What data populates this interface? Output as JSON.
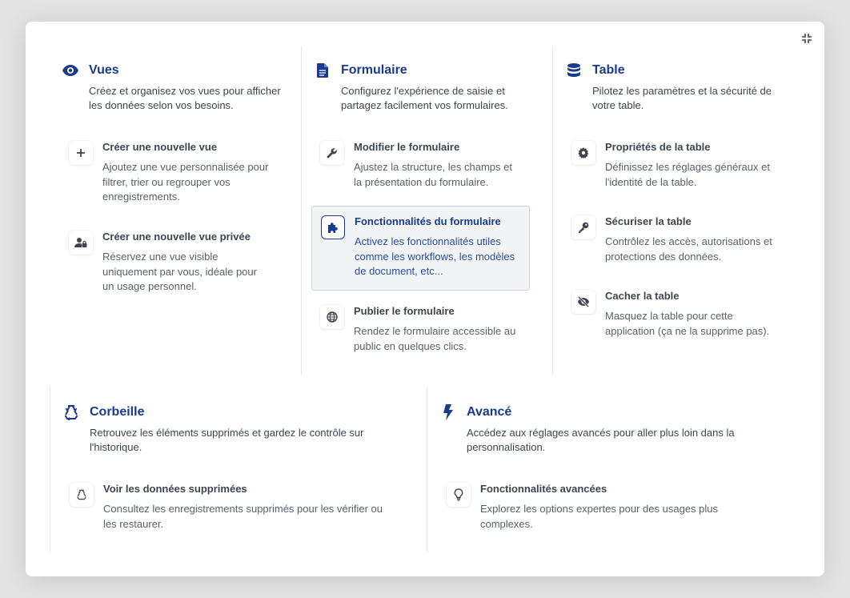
{
  "vues": {
    "title": "Vues",
    "description": "Créez et organisez vos vues pour afficher les données selon vos besoins.",
    "items": [
      {
        "title": "Créer une nouvelle vue",
        "description": "Ajoutez une vue personnalisée pour filtrer, trier ou regrouper vos enregistrements.",
        "icon": "plus-icon"
      },
      {
        "title": "Créer une nouvelle vue privée",
        "description": "Réservez une vue visible uniquement par vous, idéale pour un usage personnel.",
        "icon": "user-lock-icon"
      }
    ]
  },
  "formulaire": {
    "title": "Formulaire",
    "description": "Configurez l'expérience de saisie et partagez facilement vos formulaires.",
    "items": [
      {
        "title": "Modifier le formulaire",
        "description": "Ajustez la structure, les champs et la présentation du formulaire.",
        "icon": "wrench-icon"
      },
      {
        "title": "Fonctionnalités du formulaire",
        "description": "Activez les fonctionnalités utiles comme les workflows, les modèles de document, etc...",
        "icon": "puzzle-icon"
      },
      {
        "title": "Publier le formulaire",
        "description": "Rendez le formulaire accessible au public en quelques clics.",
        "icon": "globe-icon"
      }
    ]
  },
  "table": {
    "title": "Table",
    "description": "Pilotez les paramètres et la sécurité de votre table.",
    "items": [
      {
        "title": "Propriétés de la table",
        "description": "Définissez les réglages généraux et l'identité de la table.",
        "icon": "gear-icon"
      },
      {
        "title": "Sécuriser la table",
        "description": "Contrôlez les accès, autorisations et protections des données.",
        "icon": "key-icon"
      },
      {
        "title": "Cacher la table",
        "description": "Masquez la table pour cette application (ça ne la supprime pas).",
        "icon": "eye-slash-icon"
      }
    ]
  },
  "corbeille": {
    "title": "Corbeille",
    "description": "Retrouvez les éléments supprimés et gardez le contrôle sur l'historique.",
    "items": [
      {
        "title": "Voir les données supprimées",
        "description": "Consultez les enregistrements supprimés pour les vérifier ou les restaurer.",
        "icon": "recycle-icon"
      }
    ]
  },
  "avance": {
    "title": "Avancé",
    "description": "Accédez aux réglages avancés pour aller plus loin dans la personnalisation.",
    "items": [
      {
        "title": "Fonctionnalités avancées",
        "description": "Explorez les options expertes pour des usages plus complexes.",
        "icon": "lightbulb-icon"
      }
    ]
  },
  "colors": {
    "accent": "#1a3a8a",
    "text": "#3f4550",
    "muted": "#5b616b"
  }
}
